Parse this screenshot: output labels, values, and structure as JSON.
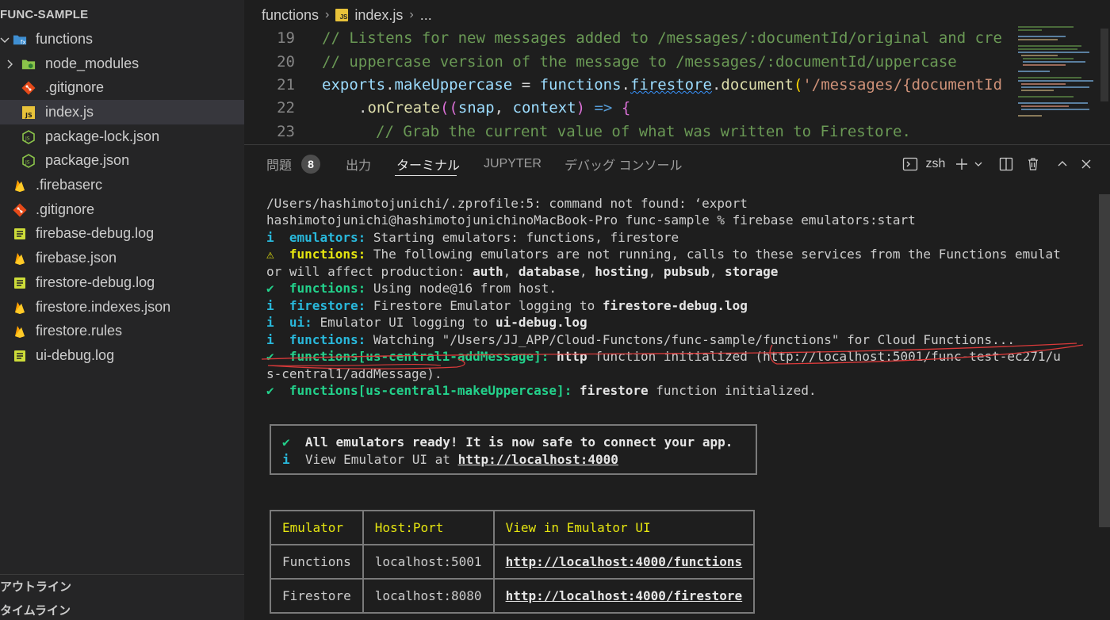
{
  "sidebar": {
    "title": "FUNC-SAMPLE",
    "items": [
      {
        "label": "functions",
        "icon": "functions-folder-icon",
        "kind": "folder-open"
      },
      {
        "label": "node_modules",
        "icon": "node-folder-icon",
        "kind": "folder-closed"
      },
      {
        "label": ".gitignore",
        "icon": "git-icon",
        "kind": "file"
      },
      {
        "label": "index.js",
        "icon": "js-file-icon",
        "kind": "file",
        "selected": true
      },
      {
        "label": "package-lock.json",
        "icon": "nodejs-icon",
        "kind": "file"
      },
      {
        "label": "package.json",
        "icon": "nodejs-icon",
        "kind": "file"
      },
      {
        "label": ".firebaserc",
        "icon": "firebase-icon",
        "kind": "file"
      },
      {
        "label": ".gitignore",
        "icon": "git-icon",
        "kind": "file"
      },
      {
        "label": "firebase-debug.log",
        "icon": "log-file-icon",
        "kind": "file"
      },
      {
        "label": "firebase.json",
        "icon": "firebase-icon",
        "kind": "file"
      },
      {
        "label": "firestore-debug.log",
        "icon": "log-file-icon",
        "kind": "file"
      },
      {
        "label": "firestore.indexes.json",
        "icon": "firebase-icon",
        "kind": "file"
      },
      {
        "label": "firestore.rules",
        "icon": "firebase-icon",
        "kind": "file"
      },
      {
        "label": "ui-debug.log",
        "icon": "log-file-icon",
        "kind": "file"
      }
    ],
    "sections": {
      "outline": "アウトライン",
      "timeline": "タイムライン"
    }
  },
  "editor": {
    "breadcrumb": {
      "folder": "functions",
      "file": "index.js",
      "more": "..."
    },
    "lines": [
      {
        "num": "19"
      },
      {
        "num": "20"
      },
      {
        "num": "21"
      },
      {
        "num": "22"
      },
      {
        "num": "23"
      }
    ],
    "code": {
      "l19": "// Listens for new messages added to /messages/:documentId/original and cre",
      "l20": "// uppercase version of the message to /messages/:documentId/uppercase",
      "l21": {
        "a": "exports",
        "b": ".",
        "c": "makeUppercase",
        "d": " = ",
        "e": "functions",
        "f": ".",
        "g": "firestore",
        "h": ".",
        "i": "document",
        "j": "(",
        "k": "'/messages/{documentId"
      },
      "l22": {
        "a": ".",
        "b": "onCreate",
        "c": "((",
        "d": "snap",
        "e": ", ",
        "f": "context",
        "g": ") ",
        "h": "=>",
        "i": " {"
      },
      "l23": "// Grab the current value of what was written to Firestore."
    }
  },
  "panel": {
    "tabs": {
      "problems": "問題",
      "problems_count": "8",
      "output": "出力",
      "terminal": "ターミナル",
      "jupyter": "JUPYTER",
      "debug_console": "デバッグ コンソール"
    },
    "shell": "zsh",
    "terminal": {
      "l1": "/Users/hashimotojunichi/.zprofile:5: command not found: ‘export",
      "l2": "hashimotojunichi@hashimotojunichinoMacBook-Pro func-sample % firebase emulators:start",
      "l3": {
        "sym": "i",
        "tag": "emulators:",
        "text": " Starting emulators: functions, firestore"
      },
      "l4": {
        "sym": "⚠",
        "tag": "functions:",
        "text": " The following emulators are not running, calls to these services from the Functions emulat"
      },
      "l5": {
        "pre": "or will affect production: ",
        "b1": "auth",
        "s1": ", ",
        "b2": "database",
        "s2": ", ",
        "b3": "hosting",
        "s3": ", ",
        "b4": "pubsub",
        "s4": ", ",
        "b5": "storage"
      },
      "l6": {
        "sym": "✔",
        "tag": "functions:",
        "text": " Using node@16 from host."
      },
      "l7": {
        "sym": "i",
        "tag": "firestore:",
        "text": " Firestore Emulator logging to ",
        "bold": "firestore-debug.log"
      },
      "l8": {
        "sym": "i",
        "tag": "ui:",
        "text": " Emulator UI logging to ",
        "bold": "ui-debug.log"
      },
      "l9": {
        "sym": "i",
        "tag": "functions:",
        "text": " Watching \"/Users/JJ_APP/Cloud-Functons/func-sample/functions\" for Cloud Functions..."
      },
      "l10": {
        "sym": "✔",
        "tag": "functions[us-central1-addMessage]:",
        "bold": " http",
        "text": " function initialized (http://localhost:5001/func-test-ec271/u"
      },
      "l11": "s-central1/addMessage).",
      "l12": {
        "sym": "✔",
        "tag": "functions[us-central1-makeUppercase]:",
        "bold": " firestore",
        "text": " function initialized."
      }
    },
    "ready": {
      "sym1": "✔",
      "line1": "All emulators ready! It is now safe to connect your app.",
      "sym2": "i",
      "line2_pre": "View Emulator UI at ",
      "line2_link": "http://localhost:4000"
    },
    "table": {
      "headers": [
        "Emulator",
        "Host:Port",
        "View in Emulator UI"
      ],
      "rows": [
        [
          "Functions",
          "localhost:5001",
          "http://localhost:4000/functions"
        ],
        [
          "Firestore",
          "localhost:8080",
          "http://localhost:4000/firestore"
        ]
      ]
    }
  },
  "colors": {
    "sidebar_bg": "#252526",
    "editor_bg": "#1e1e1e",
    "selected_row": "#37373d",
    "annotation_red": "#d93a3a",
    "terminal_cyan": "#29b8db",
    "terminal_yellow": "#e5e510",
    "terminal_green": "#23d18b"
  }
}
